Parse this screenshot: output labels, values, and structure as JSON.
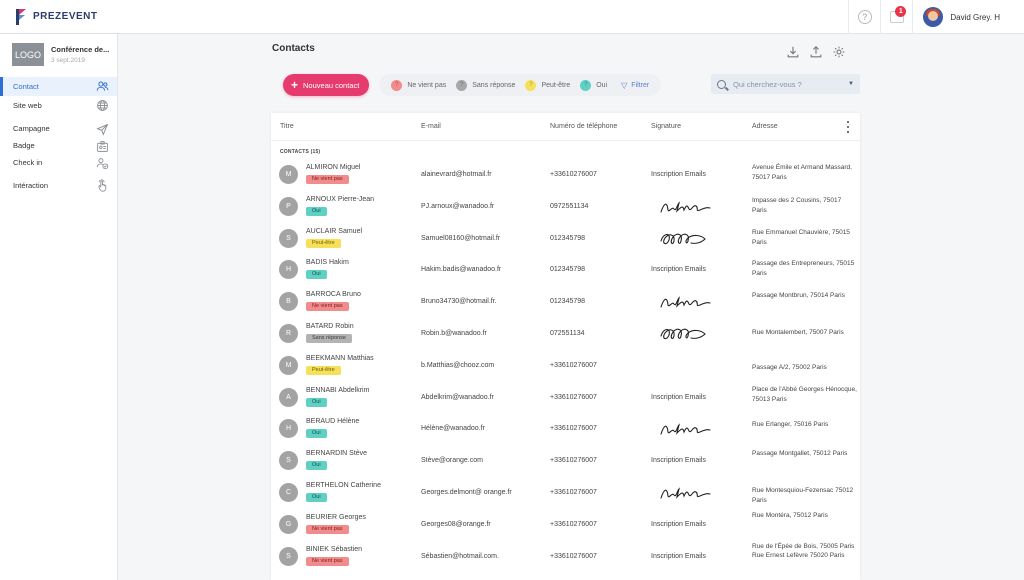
{
  "app": {
    "brand": "PREZEVENT"
  },
  "topbar": {
    "help_glyph": "?",
    "notif_count": "1",
    "user_name": "David Grey. H"
  },
  "event": {
    "logo_label": "LOGO",
    "title": "Conférence de...",
    "date": "3 sept.2019"
  },
  "nav": [
    {
      "label": "Contact",
      "icon": "contact-users-icon",
      "active": true
    },
    {
      "label": "Site web",
      "icon": "globe-icon"
    },
    {
      "label": "Campagne",
      "icon": "send-icon"
    },
    {
      "label": "Badge",
      "icon": "badge-icon"
    },
    {
      "label": "Check in",
      "icon": "checkin-icon"
    },
    {
      "label": "Intéraction",
      "icon": "touch-icon"
    }
  ],
  "page": {
    "title": "Contacts"
  },
  "toolbar": {
    "new_contact": "Nouveau contact",
    "filters": [
      {
        "label": "Ne vient pas",
        "color": "#f28b8b",
        "glyph": "?"
      },
      {
        "label": "Sans réponse",
        "color": "#a8a8a8",
        "glyph": "?"
      },
      {
        "label": "Peut-être",
        "color": "#f6e05a",
        "glyph": "?"
      },
      {
        "label": "Oui",
        "color": "#5fd0c4",
        "glyph": "?"
      }
    ],
    "filter_label": "Filtrer"
  },
  "search": {
    "placeholder": "Qui cherchez-vous ?"
  },
  "table": {
    "columns": {
      "title": "Titre",
      "email": "E-mail",
      "phone": "Numéro de téléphone",
      "signature": "Signature",
      "address": "Adresse"
    },
    "group_label": "CONTACTS (15)",
    "rows": [
      {
        "initial": "M",
        "name": "ALMIRON Miguel",
        "status": "Ne vient pas",
        "status_key": "nv",
        "email": "alainevrard@hotmail.fr",
        "phone": "+33610276007",
        "signature": "Inscription Emails",
        "address": "Avenue Émile et Armand Massard, 75017 Paris"
      },
      {
        "initial": "P",
        "name": "ARNOUX Pierre-Jean",
        "status": "Oui",
        "status_key": "oui",
        "email": "PJ.arnoux@wanadoo.fr",
        "phone": "0972551134",
        "signature": "",
        "signature_image": "sig1",
        "address": "Impasse des 2 Cousins, 75017 Paris"
      },
      {
        "initial": "S",
        "name": "AUCLAIR Samuel",
        "status": "Peut-être",
        "status_key": "pe",
        "email": "Samuel08160@hotmail.fr",
        "phone": "012345798",
        "signature": "",
        "signature_image": "sig2",
        "address": "Rue Emmanuel Chauvière, 75015 Paris"
      },
      {
        "initial": "H",
        "name": "BADIS Hakim",
        "status": "Oui",
        "status_key": "oui",
        "email": "Hakim.badis@wanadoo.fr",
        "phone": "012345798",
        "signature": "Inscription Emails",
        "address": "Passage des Entrepreneurs, 75015 Paris"
      },
      {
        "initial": "B",
        "name": "BARROCA Bruno",
        "status": "Ne vient pas",
        "status_key": "nv",
        "email": "Bruno34730@hotmail.fr.",
        "phone": "012345798",
        "signature": "",
        "signature_image": "sig1",
        "address": "Passage Montbrun, 75014 Paris"
      },
      {
        "initial": "R",
        "name": "BATARD Robin",
        "status": "Sans réponse",
        "status_key": "sr",
        "email": "Robin.b@wanadoo.fr",
        "phone": "072551134",
        "signature": "",
        "signature_image": "sig2",
        "address": "Rue Montalembert, 75007 Paris"
      },
      {
        "initial": "M",
        "name": "BEEKMANN Matthias",
        "status": "Peut-être",
        "status_key": "pe",
        "email": "b.Matthias@chooz.com",
        "phone": "+33610276007",
        "signature": "",
        "address": "Passage A/2, 75002 Paris"
      },
      {
        "initial": "A",
        "name": "BENNABI Abdelkrim",
        "status": "Oui",
        "status_key": "oui",
        "email": "Abdelkrim@wanadoo.fr",
        "phone": "+33610276007",
        "signature": "Inscription Emails",
        "address": "Place de l'Abbé Georges Hénocque, 75013 Paris"
      },
      {
        "initial": "H",
        "name": "BERAUD Hélène",
        "status": "Oui",
        "status_key": "oui",
        "email": "Hélène@wanadoo.fr",
        "phone": "+33610276007",
        "signature": "",
        "signature_image": "sig1",
        "address": "Rue Erlanger, 75016 Paris"
      },
      {
        "initial": "S",
        "name": "BERNARDIN Stève",
        "status": "Oui",
        "status_key": "oui",
        "email": "Stève@orange.com",
        "phone": "+33610276007",
        "signature": "Inscription Emails",
        "address": "Passage Montgallet, 75012 Paris"
      },
      {
        "initial": "C",
        "name": "BERTHELON Catherine",
        "status": "Oui",
        "status_key": "oui",
        "email": "Georges.delmont@ orange.fr",
        "phone": "+33610276007",
        "signature": "",
        "signature_image": "sig1",
        "address": "Rue Montesquiou-Fezensac 75012 Paris"
      },
      {
        "initial": "G",
        "name": "BEURIER Georges",
        "status": "Ne vient pas",
        "status_key": "nv",
        "email": "Georges08@orange.fr",
        "phone": "+33610276007",
        "signature": "Inscription Emails",
        "address": "Rue Montéra, 75012 Paris"
      },
      {
        "initial": "S",
        "name": "BINIEK Sébastien",
        "status": "Ne vient pas",
        "status_key": "nv",
        "email": "Sébastien@hotmail.com.",
        "phone": "+33610276007",
        "signature": "Inscription Emails",
        "address": "Rue de l'Épée de Bois, 75005 Paris"
      }
    ],
    "trailing_address": "Rue Ernest Lefèvre 75020 Paris"
  }
}
